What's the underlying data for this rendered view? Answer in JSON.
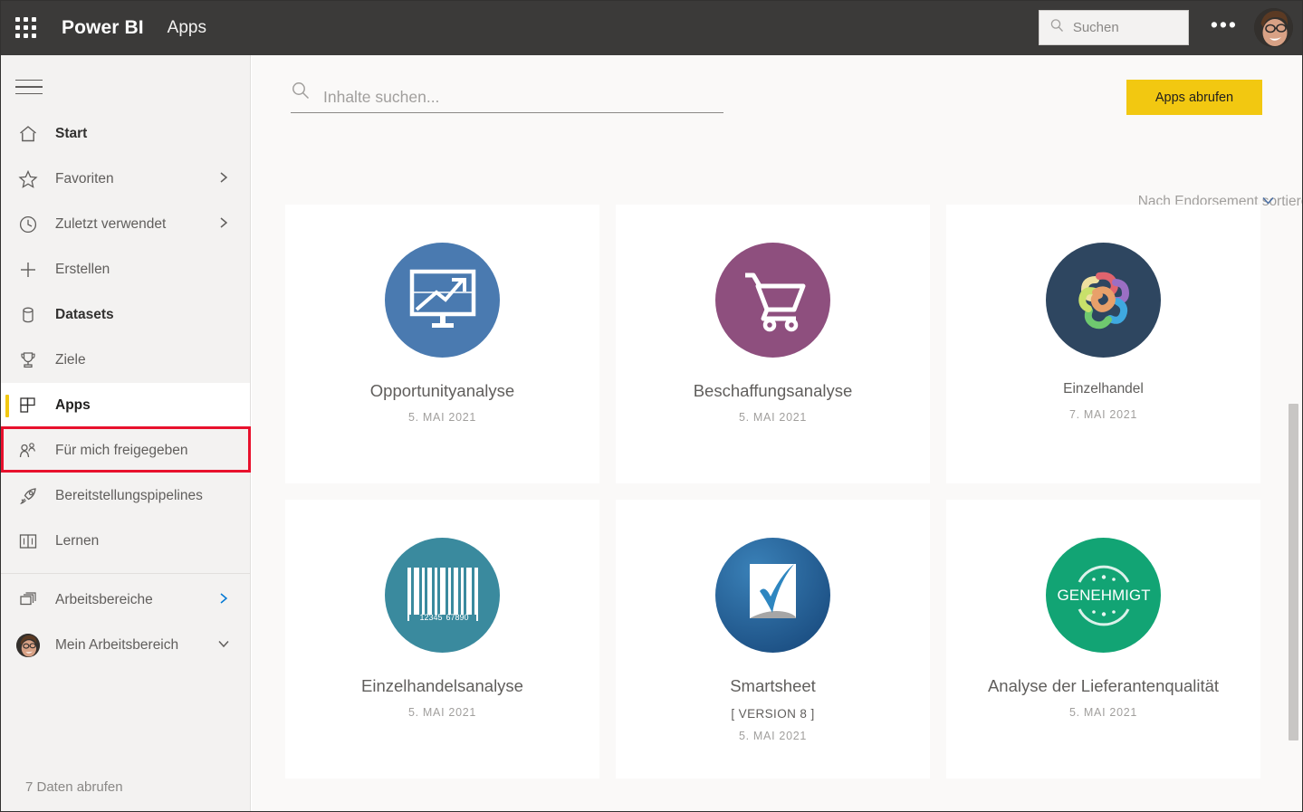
{
  "topbar": {
    "waffle_label": "app-launcher",
    "brand": "Power BI",
    "section": "Apps",
    "search_placeholder": "Suchen",
    "more_label": "•••"
  },
  "sidebar": {
    "items": [
      {
        "label": "Start",
        "icon": "home-icon",
        "bold": true,
        "chevron": ""
      },
      {
        "label": "Favoriten",
        "icon": "star-icon",
        "bold": false,
        "chevron": "right"
      },
      {
        "label": "Zuletzt verwendet",
        "icon": "clock-icon",
        "bold": false,
        "chevron": "right"
      },
      {
        "label": "Erstellen",
        "icon": "plus-icon",
        "bold": false,
        "chevron": ""
      },
      {
        "label": "Datasets",
        "icon": "dataset-icon",
        "bold": true,
        "chevron": ""
      },
      {
        "label": "Ziele",
        "icon": "trophy-icon",
        "bold": false,
        "chevron": ""
      },
      {
        "label": "Apps",
        "icon": "apps-grid-icon",
        "bold": true,
        "chevron": "",
        "active": true
      },
      {
        "label": "Für mich freigegeben",
        "icon": "shared-person-icon",
        "bold": false,
        "chevron": ""
      },
      {
        "label": "Bereitstellungspipelines",
        "icon": "rocket-icon",
        "bold": false,
        "chevron": ""
      },
      {
        "label": "Lernen",
        "icon": "book-icon",
        "bold": false,
        "chevron": ""
      },
      {
        "label": "Arbeitsbereiche",
        "icon": "workspaces-icon",
        "bold": false,
        "chevron": "right"
      },
      {
        "label": "Mein Arbeitsbereich",
        "icon": "avatar-icon",
        "bold": false,
        "chevron": "down"
      }
    ],
    "footer_label": "7 Daten abrufen"
  },
  "main": {
    "search_placeholder": "Inhalte suchen...",
    "get_apps_label": "Apps abrufen",
    "sort_label": "Nach Endorsement sortieren",
    "cards": [
      {
        "title": "Opportunityanalyse",
        "version": "",
        "date": "5. MAI 2021",
        "icon": "monitor-chart-icon",
        "circle_color": "#4a7ab0",
        "small_title": false
      },
      {
        "title": "Beschaffungsanalyse",
        "version": "",
        "date": "5. MAI 2021",
        "icon": "shopping-cart-icon",
        "circle_color": "#8e4f7e",
        "small_title": false
      },
      {
        "title": "Einzelhandel",
        "version": "",
        "date": "7. MAI 2021",
        "icon": "colorful-knot-icon",
        "circle_color": "#2e4660",
        "small_title": true
      },
      {
        "title": "Einzelhandelsanalyse",
        "version": "",
        "date": "5. MAI 2021",
        "icon": "barcode-icon",
        "circle_color": "#3a8a9e",
        "small_title": false,
        "barcode_digits_left": "12345",
        "barcode_digits_right": "67890"
      },
      {
        "title": "Smartsheet",
        "version": "[ VERSION 8 ]",
        "date": "5. MAI 2021",
        "icon": "smartsheet-check-icon",
        "circle_color": "#27679c",
        "small_title": false
      },
      {
        "title": "Analyse der Lieferantenqualität",
        "version": "",
        "date": "5. MAI 2021",
        "icon": "approved-seal-icon",
        "circle_color": "#12a474",
        "small_title": false,
        "badge_text": "GENEHMIGT"
      }
    ]
  },
  "colors": {
    "topbar_bg": "#3b3a39",
    "sidebar_bg": "#f3f2f1",
    "canvas_bg": "#faf9f8",
    "accent_yellow": "#f2c811",
    "annotation_red": "#e8112d"
  }
}
